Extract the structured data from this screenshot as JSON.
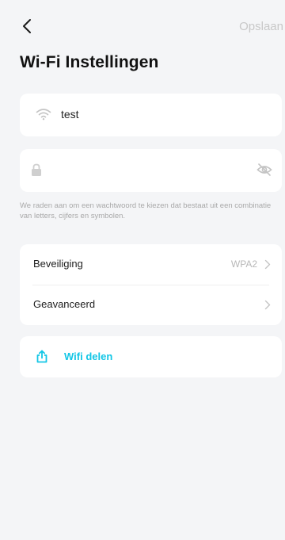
{
  "header": {
    "save_label": "Opslaan",
    "title": "Wi-Fi Instellingen"
  },
  "ssid": {
    "value": "test",
    "icon": "wifi-icon"
  },
  "password": {
    "value": "",
    "icon": "lock-icon",
    "toggle_icon": "eye-slash-icon"
  },
  "hint": "We raden aan om een wachtwoord te kiezen dat bestaat uit een combinatie van letters, cijfers en symbolen.",
  "settings": {
    "security_label": "Beveiliging",
    "security_value": "WPA2",
    "advanced_label": "Geavanceerd"
  },
  "share": {
    "label": "Wifi delen",
    "icon": "share-icon"
  },
  "colors": {
    "accent": "#12c6e6",
    "background": "#f4f5f7",
    "card": "#ffffff",
    "muted": "#b8b8b8"
  }
}
